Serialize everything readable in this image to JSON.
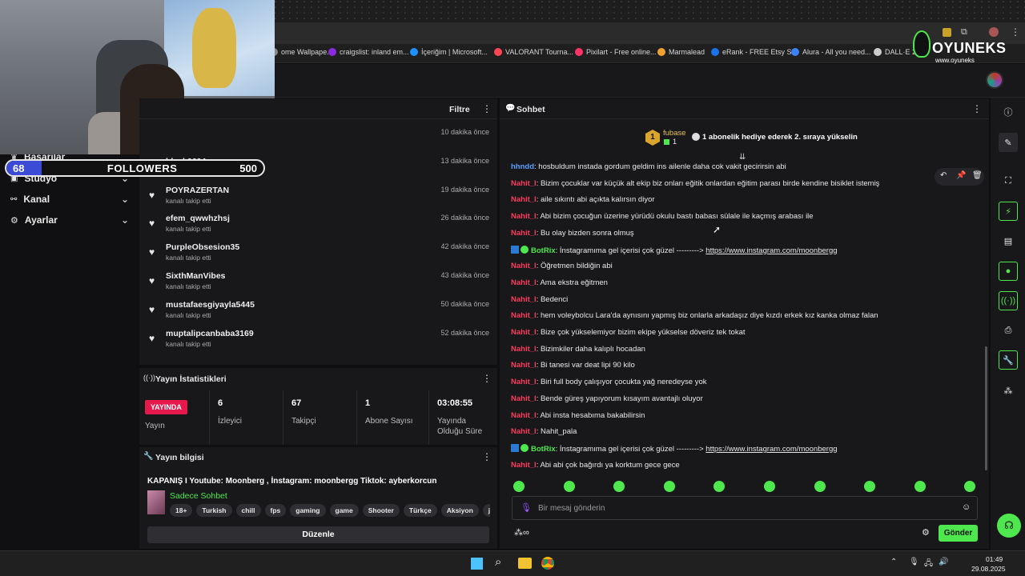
{
  "browser": {
    "bookmarks": [
      {
        "label": "ome Wallpape...",
        "color": "#888888"
      },
      {
        "label": "craigslist: inland em...",
        "color": "#8a2be2"
      },
      {
        "label": "İçeriğim | Microsoft...",
        "color": "#1e90ff"
      },
      {
        "label": "VALORANT Tourna...",
        "color": "#ff4655"
      },
      {
        "label": "Pixilart - Free online...",
        "color": "#ff3366"
      },
      {
        "label": "Marmalead",
        "color": "#f0a030"
      },
      {
        "label": "eRank - FREE Etsy S...",
        "color": "#1a73e8"
      },
      {
        "label": "Alura - All you need...",
        "color": "#3b82f6"
      },
      {
        "label": "DALL·E 2",
        "color": "#cccccc"
      }
    ]
  },
  "watermark": {
    "brand": "OYUNEKS",
    "url": "www.oyuneks"
  },
  "followers_bar": {
    "current": "68",
    "label": "FOLLOWERS",
    "goal": "500",
    "progress": 0.136
  },
  "leftnav": {
    "items": [
      {
        "label": "Başarılar"
      },
      {
        "label": "Stüdyo"
      },
      {
        "label": "Kanal"
      },
      {
        "label": "Ayarlar"
      }
    ]
  },
  "follower_panel": {
    "filter_label": "Filtre",
    "items": [
      {
        "name": "",
        "sub": "",
        "time": "10 dakika önce"
      },
      {
        "name": "black0604",
        "sub": "kanalı takip etti",
        "time": "13 dakika önce"
      },
      {
        "name": "POYRAZERTAN",
        "sub": "kanalı takip etti",
        "time": "19 dakika önce"
      },
      {
        "name": "efem_qwwhzhsj",
        "sub": "kanalı takip etti",
        "time": "26 dakika önce"
      },
      {
        "name": "PurpleObsesion35",
        "sub": "kanalı takip etti",
        "time": "42 dakika önce"
      },
      {
        "name": "SixthManVibes",
        "sub": "kanalı takip etti",
        "time": "43 dakika önce"
      },
      {
        "name": "mustafaesgiyayla5445",
        "sub": "kanalı takip etti",
        "time": "50 dakika önce"
      },
      {
        "name": "muptalipcanbaba3169",
        "sub": "kanalı takip etti",
        "time": "52 dakika önce"
      }
    ]
  },
  "stats": {
    "title": "Yayın İstatistikleri",
    "live_badge": "YAYINDA",
    "live_label": "Yayın",
    "columns": [
      {
        "value": "6",
        "label": "İzleyici"
      },
      {
        "value": "67",
        "label": "Takipçi"
      },
      {
        "value": "1",
        "label": "Abone Sayısı"
      },
      {
        "value": "03:08:55",
        "label": "Yayında Olduğu Süre"
      }
    ]
  },
  "stream_info": {
    "title": "Yayın bilgisi",
    "stream_title": "KAPANIŞ I Youtube: Moonberg , İnstagram: moonbergg Tiktok: ayberkorcun",
    "category": "Sadece Sohbet",
    "tags": [
      "18+",
      "Turkish",
      "chill",
      "fps",
      "gaming",
      "game",
      "Shooter",
      "Türkçe",
      "Aksiyon",
      "justchatting"
    ],
    "edit_label": "Düzenle"
  },
  "chat": {
    "title": "Sohbet",
    "pinned_user": "fubase",
    "pinned_rank": "1",
    "pinned_count": "1",
    "pinned_message": "1 abonelik hediye ederek 2. sıraya yükselin",
    "messages": [
      {
        "user": "hhndd",
        "type": "blue",
        "text": ": hosbuldum instada gordum geldim ins ailenle daha cok vakit gecirirsin abi"
      },
      {
        "user": "Nahit_l",
        "type": "red",
        "text": ": Bizim çocuklar var küçük alt ekip biz onları eğitik onlardan eğitim parası birde kendine bisiklet istemiş"
      },
      {
        "user": "Nahit_l",
        "type": "red",
        "text": ": aile sıkıntı abi açıkta kalırsın diyor"
      },
      {
        "user": "Nahit_l",
        "type": "red",
        "text": ": Abi bizim çocuğun üzerine yürüdü okulu bastı babası sülale ile kaçmış arabası ile"
      },
      {
        "user": "Nahit_l",
        "type": "red",
        "text": ": Bu olay bizden sonra olmuş"
      },
      {
        "user": "BotRix",
        "type": "bot",
        "text": ": İnstagramıma gel içerisi çok güzel ---------> ",
        "link": "https://www.instagram.com/moonbergg"
      },
      {
        "user": "Nahit_l",
        "type": "red",
        "text": ": Öğretmen bildiğin abi"
      },
      {
        "user": "Nahit_l",
        "type": "red",
        "text": ": Ama ekstra eğitmen"
      },
      {
        "user": "Nahit_l",
        "type": "red",
        "text": ": Bedenci"
      },
      {
        "user": "Nahit_l",
        "type": "red",
        "text": ": hem voleybolcu Lara'da aynısını yapmış biz onlarla arkadaşız diye kızdı erkek kız kanka olmaz falan"
      },
      {
        "user": "Nahit_l",
        "type": "red",
        "text": ": Bize çok yükselemiyor bizim ekipe yükselse döveriz tek tokat"
      },
      {
        "user": "Nahit_l",
        "type": "red",
        "text": ": Bizimkiler daha kalıplı hocadan"
      },
      {
        "user": "Nahit_l",
        "type": "red",
        "text": ": Bi tanesi var deat lipi 90 kilo"
      },
      {
        "user": "Nahit_l",
        "type": "red",
        "text": ": Biri full body çalışıyor çocukta yağ neredeyse yok"
      },
      {
        "user": "Nahit_l",
        "type": "red",
        "text": ": Bende güreş yapıyorum kısayım avantajlı oluyor"
      },
      {
        "user": "Nahit_l",
        "type": "red",
        "text": ": Abi insta hesabıma bakabilirsin"
      },
      {
        "user": "Nahit_l",
        "type": "red",
        "text": ": Nahit_pala"
      },
      {
        "user": "BotRix",
        "type": "bot",
        "text": ": İnstagramıma gel içerisi çok güzel ---------> ",
        "link": "https://www.instagram.com/moonbergg"
      },
      {
        "user": "Nahit_l",
        "type": "red",
        "text": ": Abi abi çok bağırdı ya korktum gece gece"
      }
    ],
    "input_placeholder": "Bir mesaj gönderin",
    "send_label": "Gönder"
  },
  "taskbar": {
    "time": "01:49",
    "date": "29.08.2025"
  }
}
